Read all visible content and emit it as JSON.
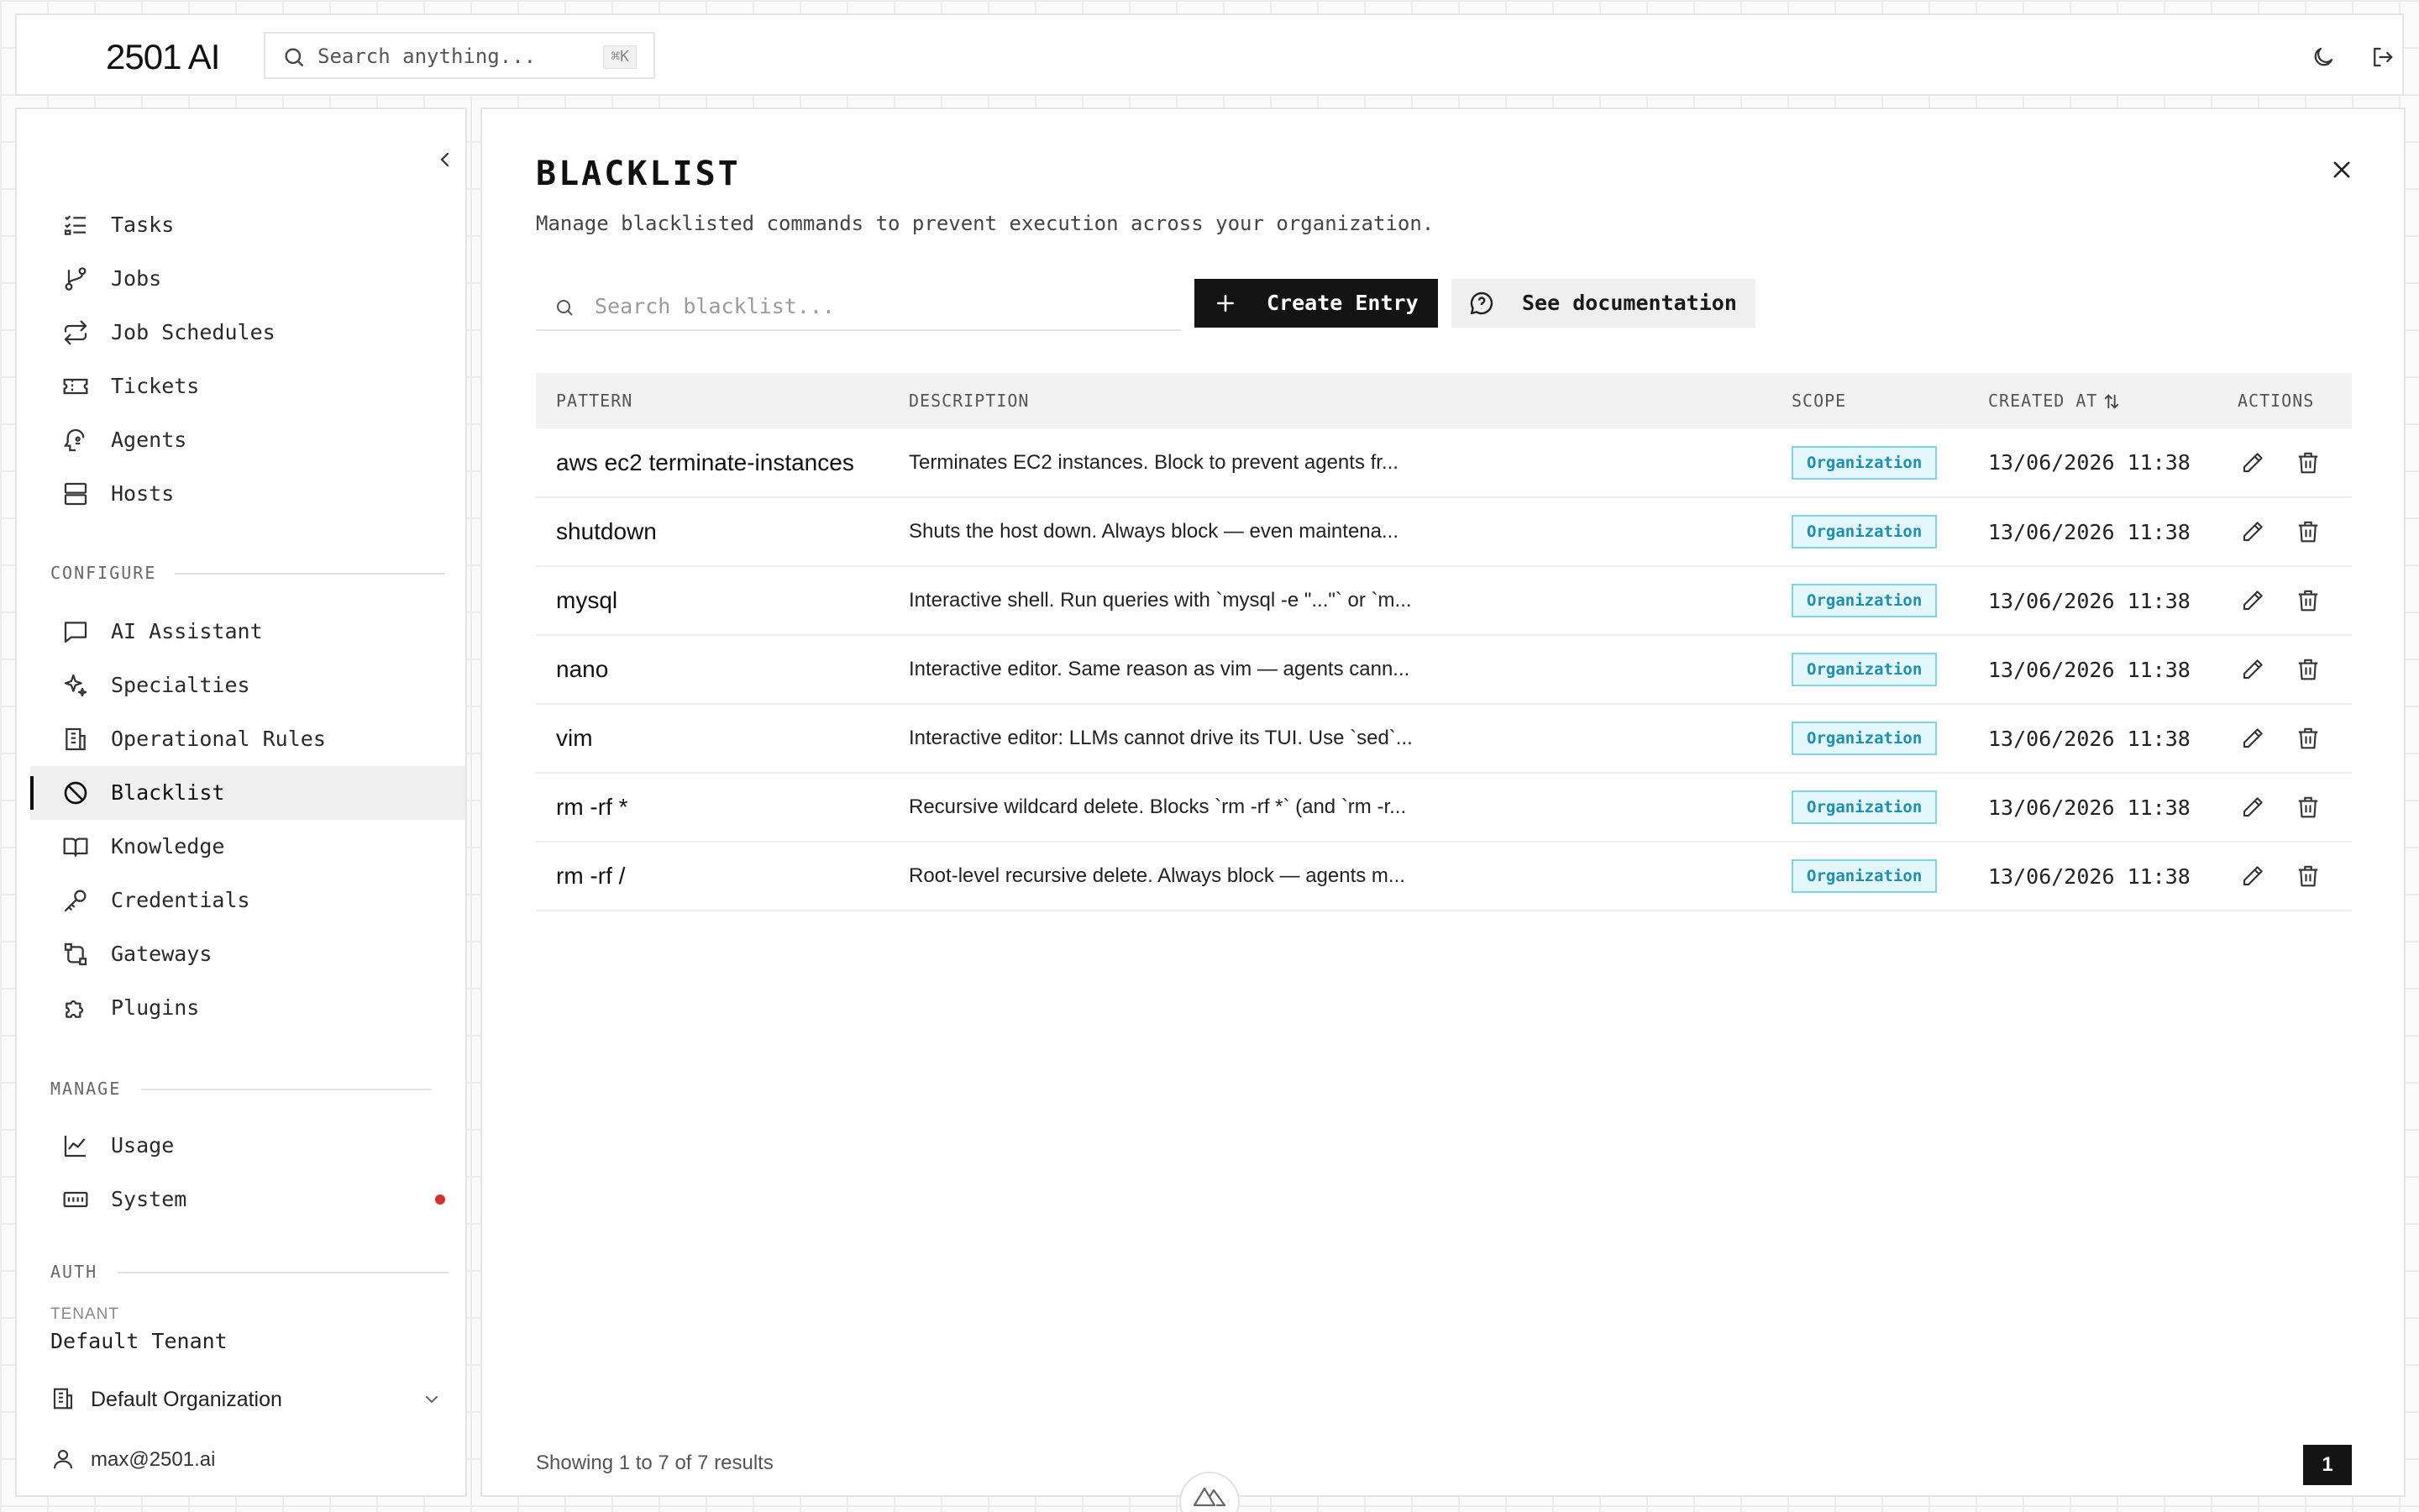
{
  "app": {
    "logo_text": "2501 AI"
  },
  "header": {
    "search_placeholder": "Search anything...",
    "search_shortcut": "⌘K",
    "icons": [
      "moon-icon",
      "logout-icon"
    ]
  },
  "sidebar": {
    "items": [
      {
        "label": "Tasks",
        "icon": "tasks-list-icon"
      },
      {
        "label": "Jobs",
        "icon": "git-branch-icon"
      },
      {
        "label": "Job Schedules",
        "icon": "repeat-icon"
      },
      {
        "label": "Tickets",
        "icon": "ticket-icon"
      },
      {
        "label": "Agents",
        "icon": "agent-icon"
      },
      {
        "label": "Hosts",
        "icon": "server-icon"
      }
    ],
    "configure_label": "CONFIGURE",
    "configure_items": [
      {
        "label": "AI Assistant",
        "icon": "chat-icon"
      },
      {
        "label": "Specialties",
        "icon": "sparkles-icon"
      },
      {
        "label": "Operational Rules",
        "icon": "building-icon"
      },
      {
        "label": "Blacklist",
        "icon": "ban-icon",
        "active": true
      },
      {
        "label": "Knowledge",
        "icon": "book-icon"
      },
      {
        "label": "Credentials",
        "icon": "key-icon"
      },
      {
        "label": "Gateways",
        "icon": "gateway-icon"
      },
      {
        "label": "Plugins",
        "icon": "puzzle-icon"
      }
    ],
    "manage_label": "MANAGE",
    "manage_items": [
      {
        "label": "Usage",
        "icon": "chart-line-icon"
      },
      {
        "label": "System",
        "icon": "system-icon",
        "alert_color": "#d32f2f"
      }
    ],
    "auth_label": "AUTH",
    "tenant_label": "TENANT",
    "tenant_value": "Default Tenant",
    "organization": "Default Organization",
    "user_email": "max@2501.ai"
  },
  "page": {
    "title": "BLACKLIST",
    "subtitle": "Manage blacklisted commands to prevent execution across your organization.",
    "search_placeholder": "Search blacklist...",
    "create_label": "Create Entry",
    "docs_label": "See documentation"
  },
  "table": {
    "columns": [
      "PATTERN",
      "DESCRIPTION",
      "SCOPE",
      "CREATED AT",
      "ACTIONS"
    ],
    "rows": [
      {
        "pattern": "aws ec2 terminate-instances",
        "description": "Terminates EC2 instances. Block to prevent agents fr...",
        "scope": "Organization",
        "created_at": "13/06/2026 11:38"
      },
      {
        "pattern": "shutdown",
        "description": "Shuts the host down. Always block — even maintena...",
        "scope": "Organization",
        "created_at": "13/06/2026 11:38"
      },
      {
        "pattern": "mysql",
        "description": "Interactive shell. Run queries with `mysql -e \"...\"` or `m...",
        "scope": "Organization",
        "created_at": "13/06/2026 11:38"
      },
      {
        "pattern": "nano",
        "description": "Interactive editor. Same reason as vim — agents cann...",
        "scope": "Organization",
        "created_at": "13/06/2026 11:38"
      },
      {
        "pattern": "vim",
        "description": "Interactive editor: LLMs cannot drive its TUI. Use `sed`...",
        "scope": "Organization",
        "created_at": "13/06/2026 11:38"
      },
      {
        "pattern": "rm -rf *",
        "description": "Recursive wildcard delete. Blocks `rm -rf *` (and `rm -r...",
        "scope": "Organization",
        "created_at": "13/06/2026 11:38"
      },
      {
        "pattern": "rm -rf /",
        "description": "Root-level recursive delete. Always block — agents m...",
        "scope": "Organization",
        "created_at": "13/06/2026 11:38"
      }
    ]
  },
  "pagination": {
    "summary": "Showing 1 to 7 of 7 results",
    "current_page": "1"
  },
  "colors": {
    "primary": "#141414",
    "badge_text": "#1c8fb5",
    "badge_bg": "#e3f6fc",
    "alert": "#d32f2f"
  }
}
